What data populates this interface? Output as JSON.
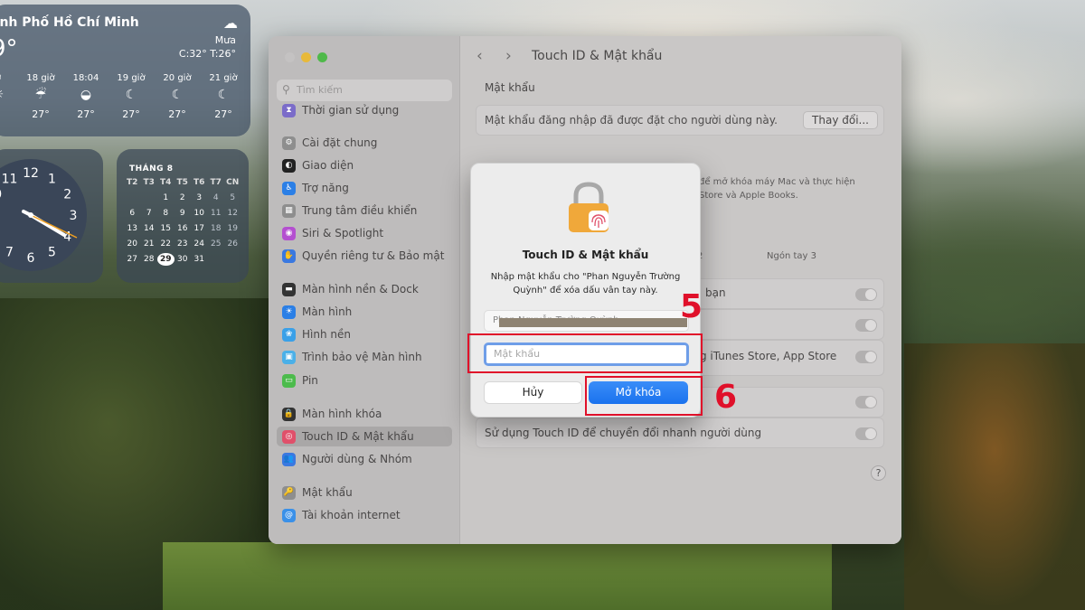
{
  "weather": {
    "city": "ành Phố Hồ Chí Minh",
    "temp": "9°",
    "icon": "cloud-rain-icon",
    "condition": "Mưa",
    "high_low": "C:32° T:26°",
    "hours": [
      {
        "time": "ờ",
        "icon": "sun",
        "temp": "°"
      },
      {
        "time": "18 giờ",
        "icon": "rain",
        "temp": "27°"
      },
      {
        "time": "18:04",
        "icon": "sunset",
        "temp": "27°"
      },
      {
        "time": "19 giờ",
        "icon": "moon-rain",
        "temp": "27°"
      },
      {
        "time": "20 giờ",
        "icon": "moon-rain",
        "temp": "27°"
      },
      {
        "time": "21 giờ",
        "icon": "moon-rain",
        "temp": "27°"
      }
    ]
  },
  "clock": {
    "numerals": [
      "12",
      "1",
      "2",
      "3",
      "4",
      "5",
      "6",
      "7",
      "8",
      "9",
      "10",
      "11"
    ]
  },
  "calendar": {
    "month": "THÁNG 8",
    "headers": [
      "T2",
      "T3",
      "T4",
      "T5",
      "T6",
      "T7",
      "CN"
    ],
    "rows": [
      [
        "",
        "",
        "1",
        "2",
        "3",
        "4",
        "5"
      ],
      [
        "6",
        "7",
        "8",
        "9",
        "10",
        "11",
        "12"
      ],
      [
        "13",
        "14",
        "15",
        "16",
        "17",
        "18",
        "19"
      ],
      [
        "20",
        "21",
        "22",
        "23",
        "24",
        "25",
        "26"
      ],
      [
        "27",
        "28",
        "29",
        "30",
        "31",
        "",
        ""
      ]
    ],
    "row_labels_note": "",
    "today": "29"
  },
  "window": {
    "search_placeholder": "Tìm kiếm",
    "sidebar": [
      {
        "label": "Thời gian sử dụng",
        "color": "#7b6cc9",
        "glyph": "⧗"
      },
      {
        "label": "Cài đặt chung",
        "color": "#8e8e8e",
        "glyph": "⚙"
      },
      {
        "label": "Giao diện",
        "color": "#222222",
        "glyph": "◐"
      },
      {
        "label": "Trợ năng",
        "color": "#2b7fe6",
        "glyph": "♿"
      },
      {
        "label": "Trung tâm điều khiển",
        "color": "#8e8e8e",
        "glyph": "▦"
      },
      {
        "label": "Siri & Spotlight",
        "color": "#b44fd0",
        "glyph": "◉"
      },
      {
        "label": "Quyền riêng tư & Bảo mật",
        "color": "#3a78e0",
        "glyph": "✋"
      },
      {
        "label": "Màn hình nền & Dock",
        "color": "#333333",
        "glyph": "▬"
      },
      {
        "label": "Màn hình",
        "color": "#2b7fe6",
        "glyph": "☀"
      },
      {
        "label": "Hình nền",
        "color": "#3aa0e8",
        "glyph": "❀"
      },
      {
        "label": "Trình bảo vệ Màn hình",
        "color": "#4bb0e8",
        "glyph": "▣"
      },
      {
        "label": "Pin",
        "color": "#4cbb4c",
        "glyph": "▭"
      },
      {
        "label": "Màn hình khóa",
        "color": "#333333",
        "glyph": "🔒"
      },
      {
        "label": "Touch ID & Mật khẩu",
        "color": "#e0506a",
        "glyph": "◎"
      },
      {
        "label": "Người dùng & Nhóm",
        "color": "#3a78e0",
        "glyph": "👥"
      },
      {
        "label": "Mật khẩu",
        "color": "#8e8e8e",
        "glyph": "🔑"
      },
      {
        "label": "Tài khoản internet",
        "color": "#3a90e8",
        "glyph": "@"
      }
    ],
    "selected_index": 13,
    "title": "Touch ID & Mật khẩu",
    "section_password": "Mật khẩu",
    "password_row_text": "Mật khẩu đăng nhập đã được đặt cho người dùng này.",
    "change_button": "Thay đổi...",
    "touchid_desc_1": "để mở khóa máy Mac và thực hiện",
    "touchid_desc_2": "Store và Apple Books.",
    "finger_2_label": "2",
    "finger_3_label": "Ngón tay 3",
    "toggle_1_text": "bạn",
    "toggle_3_text": "g iTunes Store, App Store",
    "toggle_5_text": "Sử dụng Touch ID để chuyển đổi nhanh người dùng",
    "help": "?"
  },
  "dialog": {
    "title": "Touch ID & Mật khẩu",
    "message": "Nhập mật khẩu cho \"Phan Nguyễn Trường Quỳnh\" để xóa dấu vân tay này.",
    "username_value": "Phan Nguyễn Trường Quỳnh",
    "password_placeholder": "Mật khẩu",
    "cancel": "Hủy",
    "unlock": "Mở khóa"
  },
  "annotations": {
    "step_5": "5",
    "step_6": "6",
    "color": "#e0102a"
  }
}
